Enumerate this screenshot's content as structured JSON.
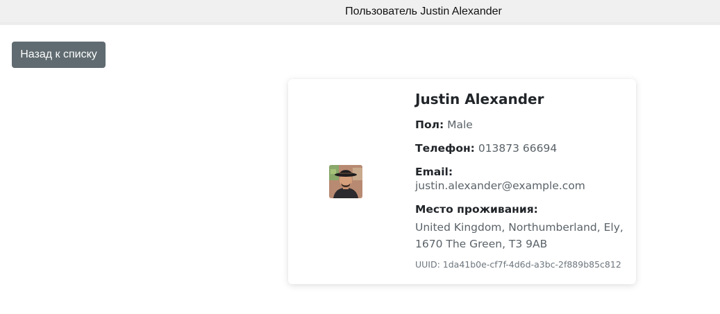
{
  "header": {
    "title": "Пользователь Justin Alexander"
  },
  "toolbar": {
    "back_label": "Назад к списку"
  },
  "profile": {
    "name": "Justin Alexander",
    "gender_label": "Пол:",
    "gender": "Male",
    "phone_label": "Телефон:",
    "phone": "013873 66694",
    "email_label": "Email:",
    "email": "justin.alexander@example.com",
    "location_label": "Место проживания:",
    "location_line1": "United Kingdom, Northumberland, Ely,",
    "location_line2": "1670 The Green, T3 9AB",
    "uuid": "UUID: 1da41b0e-cf7f-4d6d-a3bc-2f889b85c812",
    "avatar_icon": "user-photo"
  }
}
